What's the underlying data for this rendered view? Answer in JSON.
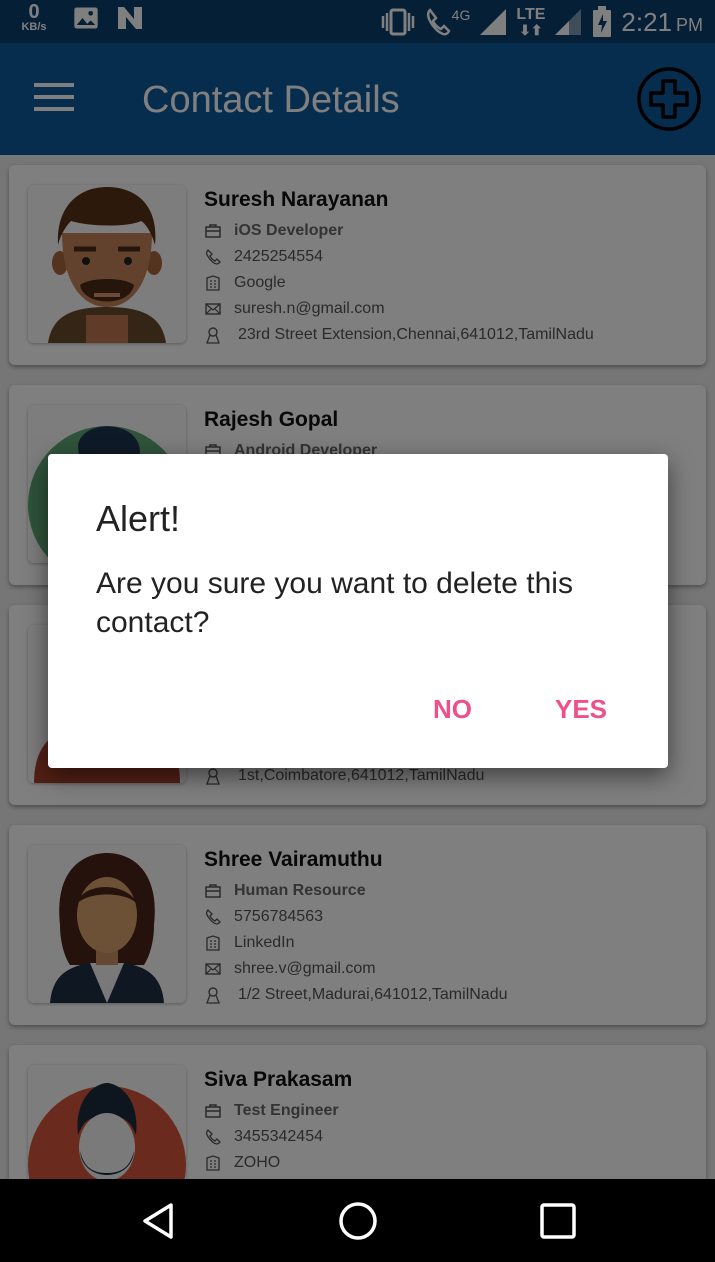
{
  "status_bar": {
    "speed_value": "0",
    "speed_unit": "KB/s",
    "network_type": "4G",
    "lte_label": "LTE",
    "time": "2:21",
    "ampm": "PM"
  },
  "app_bar": {
    "title": "Contact Details",
    "menu_icon": "hamburger-menu-icon",
    "add_icon": "add-circle-icon"
  },
  "contacts": [
    {
      "name": "Suresh Narayanan",
      "role": "iOS Developer",
      "phone": "2425254554",
      "company": "Google",
      "email": "suresh.n@gmail.com",
      "address": "23rd Street Extension,Chennai,641012,TamilNadu"
    },
    {
      "name": "Rajesh Gopal",
      "role": "Android Developer"
    },
    {
      "address": "1st,Coimbatore,641012,TamilNadu"
    },
    {
      "name": "Shree Vairamuthu",
      "role": "Human Resource",
      "phone": "5756784563",
      "company": "LinkedIn",
      "email": "shree.v@gmail.com",
      "address": "1/2 Street,Madurai,641012,TamilNadu"
    },
    {
      "name": "Siva Prakasam",
      "role": "Test Engineer",
      "phone": "3455342454",
      "company": "ZOHO"
    }
  ],
  "dialog": {
    "title": "Alert!",
    "message": "Are you sure you want to delete this contact?",
    "no_label": "NO",
    "yes_label": "YES"
  },
  "colors": {
    "status_bar": "#0a3e6e",
    "app_bar": "#0f5a9c",
    "dialog_button": "#f0508a"
  }
}
